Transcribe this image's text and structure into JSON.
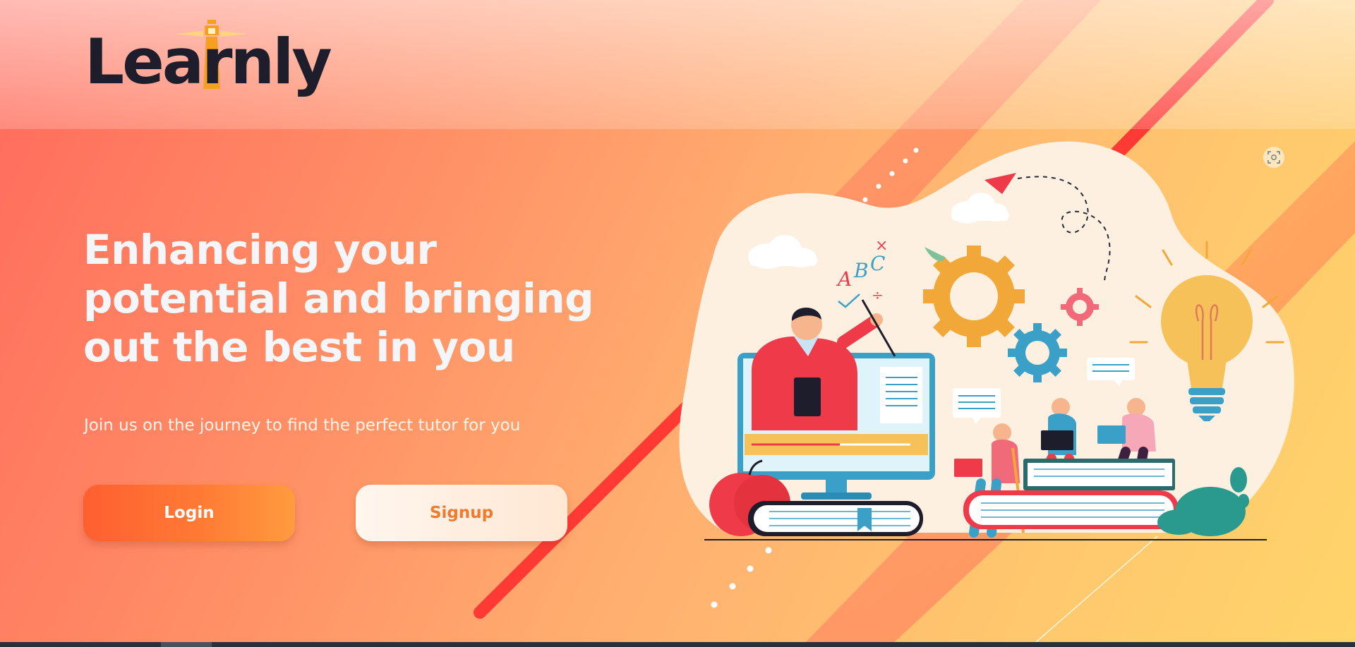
{
  "brand": {
    "name": "Learnly",
    "colors": {
      "dark": "#1d1d2b",
      "accent": "#ff6a2e",
      "lighthouse": "#f5a021"
    }
  },
  "hero": {
    "title": "Enhancing your potential and bringing out the best in you",
    "subtitle": "Join us on the journey to find the perfect tutor for you"
  },
  "actions": {
    "login_label": "Login",
    "signup_label": "Signup"
  },
  "illustration": {
    "subject": "online-tutoring-illustration",
    "blackboard_text": "ABC",
    "icon_names": [
      "gear-icon",
      "lightbulb-icon",
      "paper-plane-icon",
      "cloud-icon",
      "chat-bubble-icon",
      "book-icon",
      "apple-icon",
      "laptop-icon",
      "monitor-icon"
    ]
  },
  "tools": {
    "scan_icon": "screen-capture-icon"
  },
  "theme": {
    "gradient_start": "#ff6a5c",
    "gradient_end": "#ffd46a",
    "stripe": "#ff3a34"
  }
}
